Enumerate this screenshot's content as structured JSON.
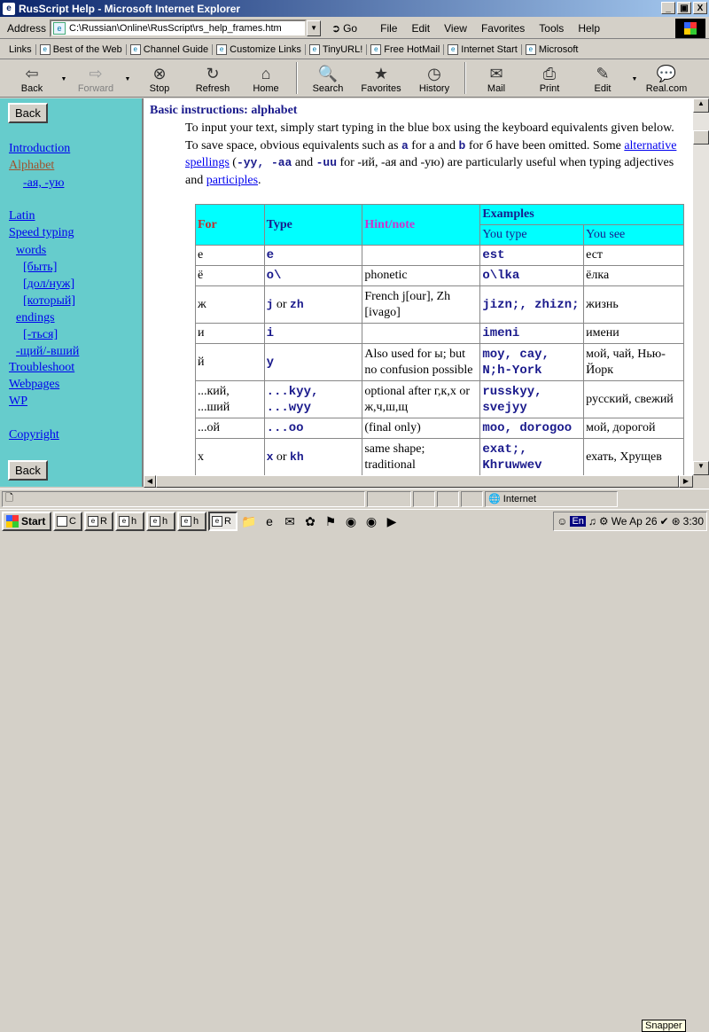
{
  "window": {
    "title": "RusScript Help - Microsoft Internet Explorer",
    "controls": [
      "_",
      "▣",
      "X"
    ]
  },
  "menubar": {
    "address_label": "Address",
    "address_value": "C:\\Russian\\Online\\RusScript\\rs_help_frames.htm",
    "go_label": "Go",
    "menus": [
      "File",
      "Edit",
      "View",
      "Favorites",
      "Tools",
      "Help"
    ]
  },
  "links_bar": {
    "label": "Links",
    "items": [
      "Best of the Web",
      "Channel Guide",
      "Customize Links",
      "TinyURL!",
      "Free HotMail",
      "Internet Start",
      "Microsoft"
    ]
  },
  "toolbar": {
    "back": "Back",
    "forward": "Forward",
    "stop": "Stop",
    "refresh": "Refresh",
    "home": "Home",
    "search": "Search",
    "favorites": "Favorites",
    "history": "History",
    "mail": "Mail",
    "print": "Print",
    "edit": "Edit",
    "realcom": "Real.com"
  },
  "nav": {
    "back_top": "Back",
    "back_bottom": "Back",
    "introduction": "Introduction",
    "alphabet": "Alphabet",
    "aya_yuyu": "-ая, -ую",
    "latin": "Latin",
    "speed_typing": "Speed typing",
    "words": "words",
    "byt": "[быть]",
    "dol_nuzh": "[дол/нуж]",
    "kotory": "[который]",
    "endings": "endings",
    "tsya": "[-ться]",
    "shchiy": "-щий/-вший",
    "troubleshoot": "Troubleshoot",
    "webpages": "Webpages",
    "wp": "WP",
    "copyright": "Copyright"
  },
  "content": {
    "heading": "Basic instructions: alphabet",
    "p1": "To input your text, simply start typing in the blue box using the keyboard equivalents given below. To save space, obvious equivalents such as ",
    "code_a": "a",
    "p2": " for а and ",
    "code_b": "b",
    "p3": " for б have been omitted. Some ",
    "link_alt": "alternative spellings",
    "p4": " (",
    "code_yy": "-yy, -aa",
    "p5": " and ",
    "code_uu": "-uu",
    "p6": " for -ий, -ая and -ую) are particularly useful when typing adjectives and ",
    "link_part": "participles",
    "p7": "."
  },
  "table": {
    "headers": {
      "for": "For",
      "type": "Type",
      "hint": "Hint/note",
      "examples": "Examples",
      "you_type": "You type",
      "you_see": "You see"
    },
    "rows": [
      {
        "for": "е",
        "type": "e",
        "type_extra": "",
        "hint": "",
        "ex_type": "est",
        "ex_see": "ест"
      },
      {
        "for": "ё",
        "type": "o\\",
        "type_extra": "",
        "hint": "phonetic",
        "ex_type": "o\\lka",
        "ex_see": "ёлка"
      },
      {
        "for": "ж",
        "type": "j",
        "type_extra": "zh",
        "hint": "French j[our], Zh [ivago]",
        "ex_type": "jizn;, zhizn;",
        "ex_see": "жизнь"
      },
      {
        "for": "и",
        "type": "i",
        "type_extra": "",
        "hint": "",
        "ex_type": "imeni",
        "ex_see": "имени"
      },
      {
        "for": "й",
        "type": "y",
        "type_extra": "",
        "hint": "Also used for ы; but no confusion possible",
        "ex_type": "moy, cay, N;h-York",
        "ex_see": "мой, чай, Нью-Йорк"
      },
      {
        "for": "...кий, ...ший",
        "type": "...kyy, ...wyy",
        "type_extra": "",
        "hint": "optional after г,к,х or ж,ч,ш,щ",
        "ex_type": "russkyy, svejyy",
        "ex_see": "русский, свежий"
      },
      {
        "for": "...ой",
        "type": "...oo",
        "type_extra": "",
        "hint": "(final only)",
        "ex_type": "moo, dorogoo",
        "ex_see": "мой, дорогой"
      },
      {
        "for": "х",
        "type": "x",
        "type_extra": "kh",
        "hint": "same shape; traditional",
        "ex_type": "exat;, Khruwwev",
        "ex_see": "ехать, Хрущев"
      }
    ],
    "or_word": "or"
  },
  "statusbar": {
    "zone": "Internet"
  },
  "taskbar": {
    "start": "Start",
    "tasks": [
      "C",
      "R",
      "h",
      "h",
      "h",
      "R"
    ],
    "tray_time": "3:30",
    "tray_text": "We Ap 26",
    "tray_lang": "En",
    "tooltip": "Snapper"
  },
  "colors": {
    "nav_bg": "#66cccc",
    "table_header": "#00ffff",
    "title_bar": "#0a246a"
  }
}
